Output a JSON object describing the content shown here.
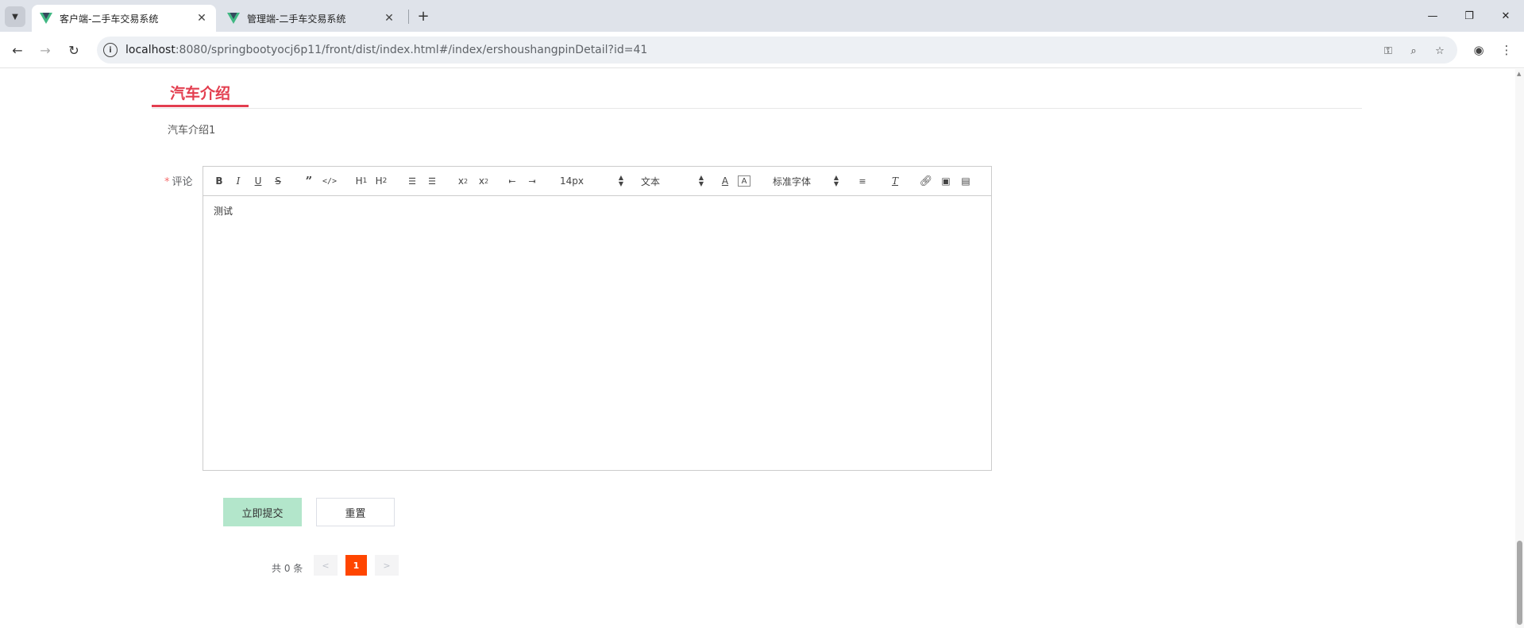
{
  "browser": {
    "tabs": [
      {
        "title": "客户端-二手车交易系统",
        "active": true
      },
      {
        "title": "管理端-二手车交易系统",
        "active": false
      }
    ],
    "url_host": "localhost",
    "url_path": ":8080/springbootyocj6p11/front/dist/index.html#/index/ershoushangpinDetail?id=41"
  },
  "page": {
    "section_title": "汽车介绍",
    "intro_text": "汽车介绍1",
    "comment_label": "评论",
    "required_mark": "*",
    "editor": {
      "font_size": "14px",
      "heading": "文本",
      "font_family": "标准字体",
      "content": "测试"
    },
    "submit_label": "立即提交",
    "reset_label": "重置",
    "pagination": {
      "total_text": "共 0 条",
      "prev": "<",
      "current_page": "1",
      "next": ">"
    }
  },
  "colors": {
    "accent": "#e33e4f",
    "submit_bg": "#b3e6cb",
    "pager_active": "#ff4500"
  }
}
